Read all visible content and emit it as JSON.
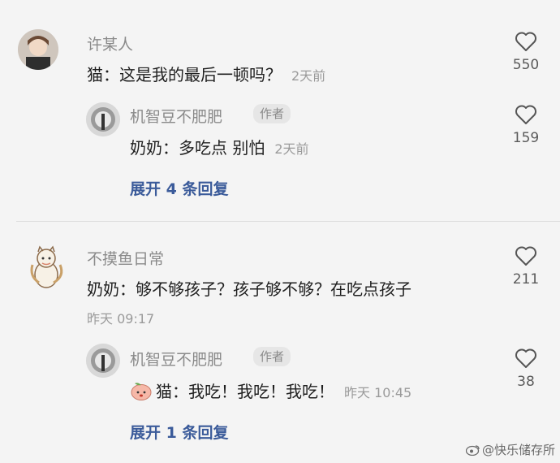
{
  "comments": [
    {
      "user": "许某人",
      "text": "猫：这是我的最后一顿吗？",
      "time": "2天前",
      "likes": "550",
      "reply": {
        "user": "机智豆不肥肥",
        "tag": "作者",
        "text": "奶奶：多吃点 别怕",
        "time": "2天前",
        "likes": "159"
      },
      "expand": "展开 4 条回复"
    },
    {
      "user": "不摸鱼日常",
      "text": "奶奶：够不够孩子？孩子够不够？在吃点孩子",
      "time": "昨天 09:17",
      "likes": "211",
      "reply": {
        "user": "机智豆不肥肥",
        "tag": "作者",
        "text": "猫：我吃！我吃！我吃！",
        "time": "昨天 10:45",
        "likes": "38"
      },
      "expand": "展开 1 条回复"
    }
  ],
  "watermark": "@快乐储存所",
  "colors": {
    "link": "#3b5b9a",
    "muted": "#8a8a8a",
    "background": "#f4f4f4"
  },
  "icons": [
    "heart-icon",
    "weibo-icon",
    "peach-emoji-icon"
  ]
}
